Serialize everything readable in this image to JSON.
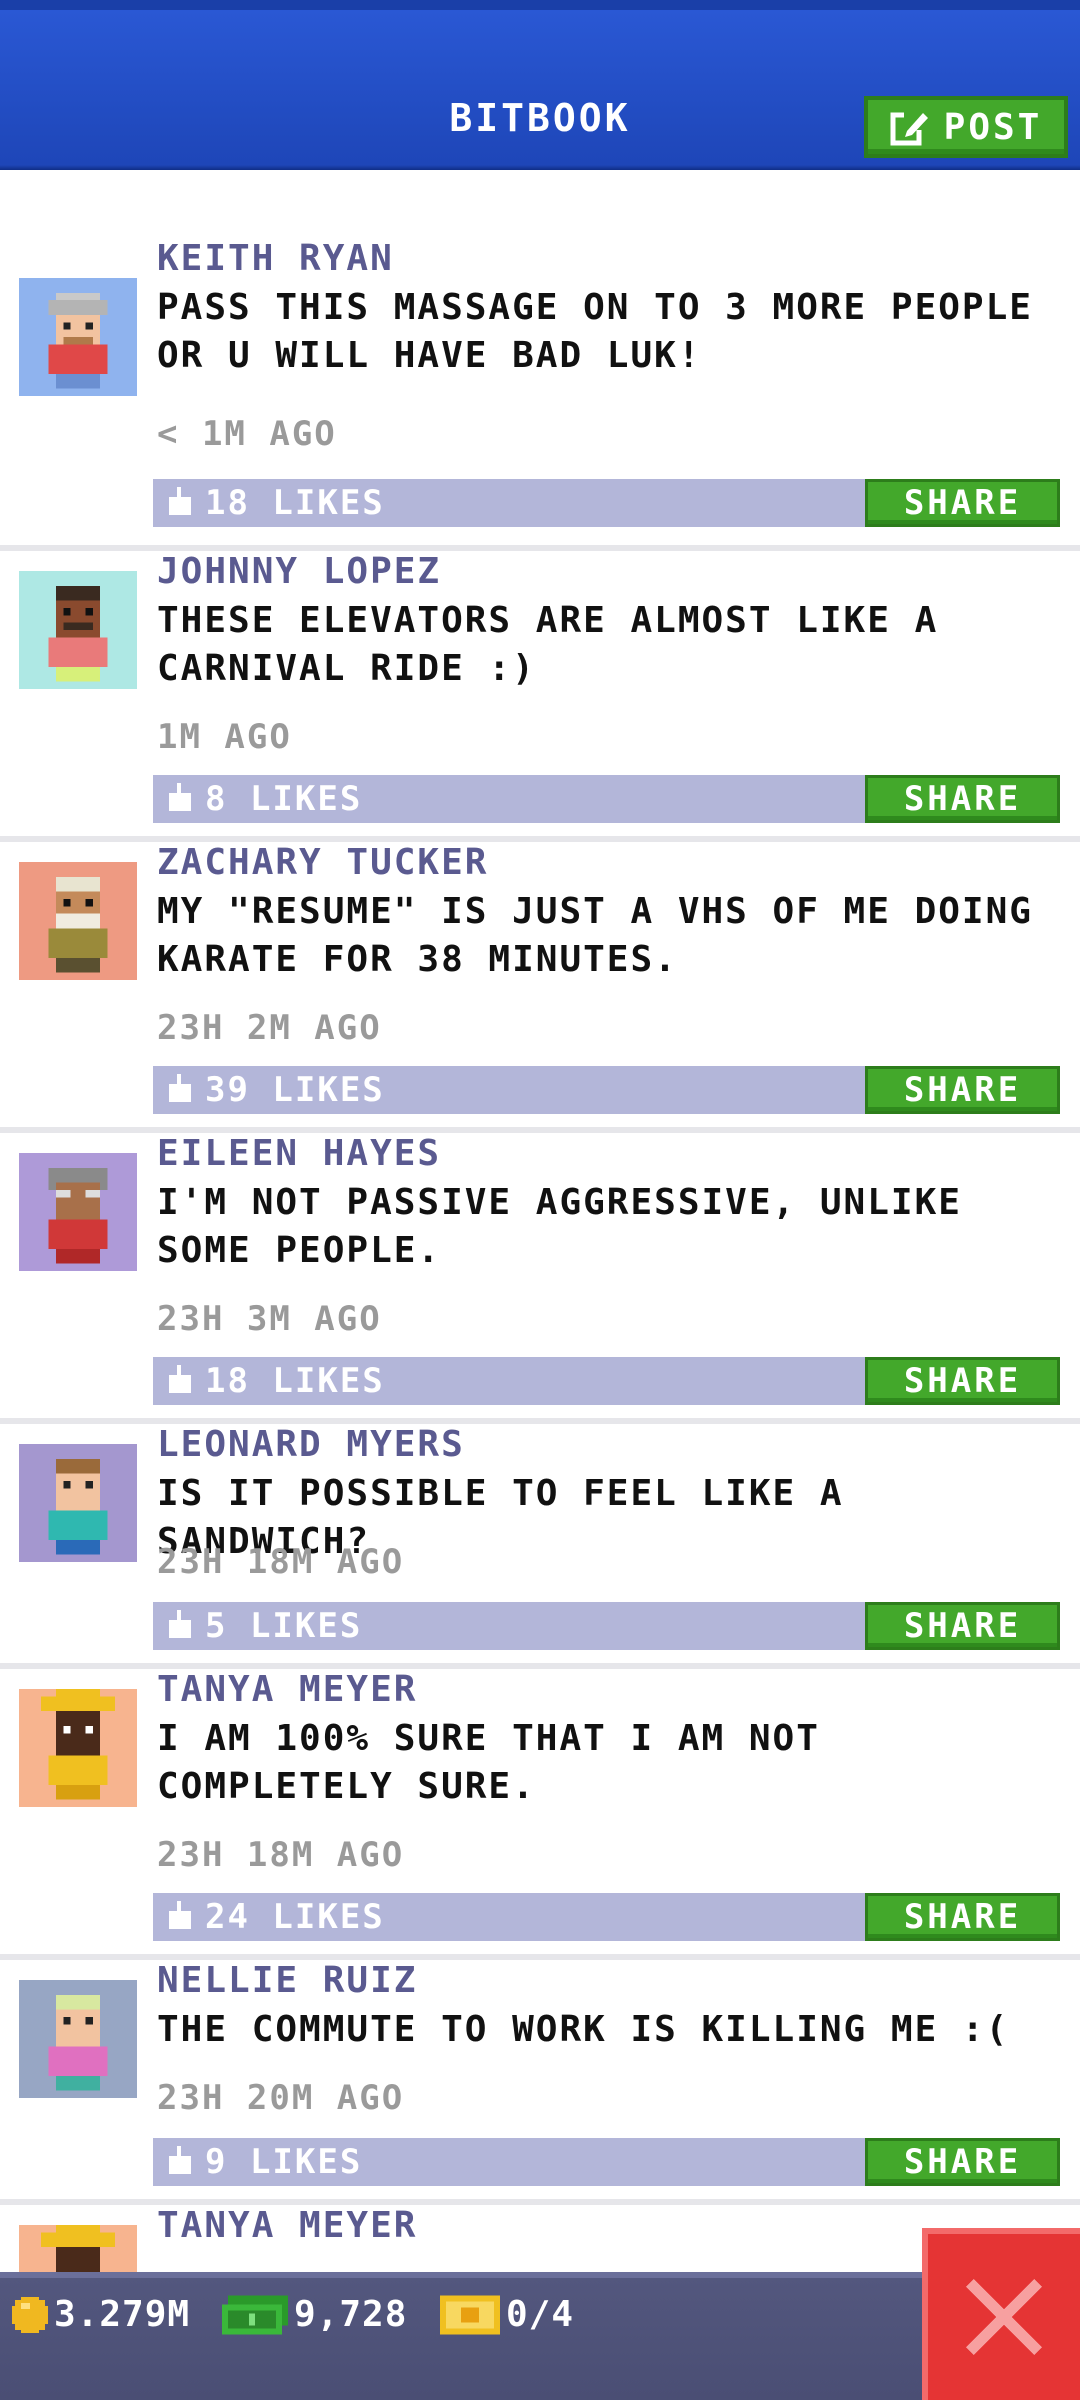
{
  "header": {
    "title": "BITBOOK",
    "post_label": "POST"
  },
  "feed": [
    {
      "name": "KEITH RYAN",
      "message": "PASS THIS MASSAGE ON TO 3 MORE PEOPLE OR U WILL HAVE BAD LUK!",
      "time": "< 1M AGO",
      "likes": "18 LIKES",
      "share": "SHARE",
      "avatar_bg": "#8fb3ee"
    },
    {
      "name": "JOHNNY LOPEZ",
      "message": "THESE ELEVATORS ARE ALMOST LIKE A CARNIVAL RIDE :)",
      "time": "1M AGO",
      "likes": "8 LIKES",
      "share": "SHARE",
      "avatar_bg": "#aee8e4"
    },
    {
      "name": "ZACHARY TUCKER",
      "message": "MY \"RESUME\" IS JUST A VHS OF ME DOING KARATE FOR 38 MINUTES.",
      "time": "23H 2M AGO",
      "likes": "39 LIKES",
      "share": "SHARE",
      "avatar_bg": "#ee9a82"
    },
    {
      "name": "EILEEN HAYES",
      "message": "I'M NOT PASSIVE AGGRESSIVE, UNLIKE SOME PEOPLE.",
      "time": "23H 3M AGO",
      "likes": "18 LIKES",
      "share": "SHARE",
      "avatar_bg": "#ae9ad8"
    },
    {
      "name": "LEONARD MYERS",
      "message": "IS IT POSSIBLE TO FEEL LIKE A SANDWICH?",
      "time": "23H 18M AGO",
      "likes": "5 LIKES",
      "share": "SHARE",
      "avatar_bg": "#a497cf"
    },
    {
      "name": "TANYA MEYER",
      "message": "I AM 100% SURE THAT I AM NOT COMPLETELY SURE.",
      "time": "23H 18M AGO",
      "likes": "24 LIKES",
      "share": "SHARE",
      "avatar_bg": "#f7b48f"
    },
    {
      "name": "NELLIE RUIZ",
      "message": "THE COMMUTE TO WORK IS KILLING ME :(",
      "time": "23H 20M AGO",
      "likes": "9 LIKES",
      "share": "SHARE",
      "avatar_bg": "#97a6c4"
    },
    {
      "name": "TANYA MEYER"
    }
  ],
  "status": {
    "coins": "3.279M",
    "bux": "9,728",
    "tickets": "0/4"
  },
  "icons": {
    "post": "edit-icon",
    "like": "thumb-up-icon",
    "coin": "coin-icon",
    "bux": "bux-icon",
    "ticket": "ticket-icon",
    "close": "close-icon"
  },
  "colors": {
    "accent_green": "#43a82b",
    "header_blue": "#1e46b8",
    "name_purple": "#5a5a90",
    "like_bar": "#b3b6d9",
    "close_red": "#e53434"
  }
}
